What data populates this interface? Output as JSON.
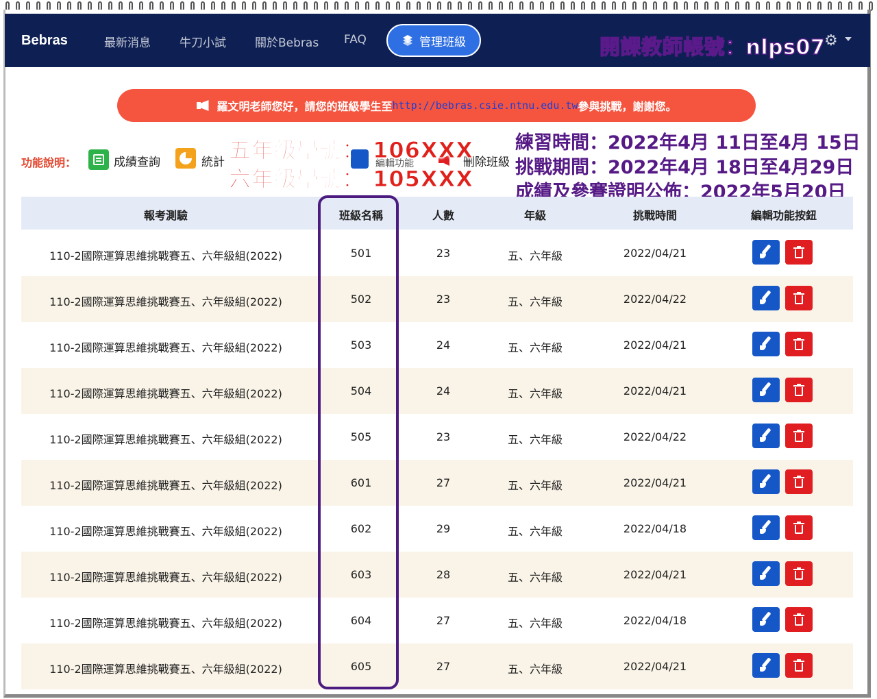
{
  "navbar": {
    "brand": "Bebras",
    "links": [
      "最新消息",
      "牛刀小試",
      "關於Bebras",
      "FAQ"
    ],
    "active_label": "管理班級",
    "teacher_prefix": "開課教師帳號：",
    "teacher_id": "nlps07"
  },
  "announcement": {
    "before": "羅文明老師您好，請您的班級學生至",
    "url": "http://bebras.csie.ntnu.edu.tw",
    "after": "參與挑戰，謝謝您。"
  },
  "legend": {
    "label": "功能說明：",
    "items": [
      "成績查詢",
      "統計",
      "編輯功能",
      "刪除班級"
    ]
  },
  "overlays": {
    "grade5": "五年級學號： 106XXX",
    "grade6": "六年級學號： 105XXX",
    "practice": "練習時間：2022年4月 11日至4月 15日",
    "challenge": "挑戰期間：2022年4月 18日至4月29日",
    "results": "成績及參賽證明公佈：2022年5月20日"
  },
  "table": {
    "headers": [
      "報考測驗",
      "班級名稱",
      "人數",
      "年級",
      "挑戰時間",
      "編輯功能按鈕"
    ],
    "rows": [
      {
        "exam": "110-2國際運算思維挑戰賽五、六年級組(2022)",
        "class": "501",
        "count": "23",
        "grade": "五、六年級",
        "date": "2022/04/21"
      },
      {
        "exam": "110-2國際運算思維挑戰賽五、六年級組(2022)",
        "class": "502",
        "count": "23",
        "grade": "五、六年級",
        "date": "2022/04/22"
      },
      {
        "exam": "110-2國際運算思維挑戰賽五、六年級組(2022)",
        "class": "503",
        "count": "24",
        "grade": "五、六年級",
        "date": "2022/04/21"
      },
      {
        "exam": "110-2國際運算思維挑戰賽五、六年級組(2022)",
        "class": "504",
        "count": "24",
        "grade": "五、六年級",
        "date": "2022/04/21"
      },
      {
        "exam": "110-2國際運算思維挑戰賽五、六年級組(2022)",
        "class": "505",
        "count": "23",
        "grade": "五、六年級",
        "date": "2022/04/22"
      },
      {
        "exam": "110-2國際運算思維挑戰賽五、六年級組(2022)",
        "class": "601",
        "count": "27",
        "grade": "五、六年級",
        "date": "2022/04/21"
      },
      {
        "exam": "110-2國際運算思維挑戰賽五、六年級組(2022)",
        "class": "602",
        "count": "29",
        "grade": "五、六年級",
        "date": "2022/04/18"
      },
      {
        "exam": "110-2國際運算思維挑戰賽五、六年級組(2022)",
        "class": "603",
        "count": "28",
        "grade": "五、六年級",
        "date": "2022/04/21"
      },
      {
        "exam": "110-2國際運算思維挑戰賽五、六年級組(2022)",
        "class": "604",
        "count": "27",
        "grade": "五、六年級",
        "date": "2022/04/18"
      },
      {
        "exam": "110-2國際運算思維挑戰賽五、六年級組(2022)",
        "class": "605",
        "count": "27",
        "grade": "五、六年級",
        "date": "2022/04/21"
      }
    ]
  },
  "colors": {
    "navbar": "#0e2053",
    "active_pill": "#2f6fe4",
    "announcement": "#f5543f",
    "edit_button": "#1657c8",
    "delete_button": "#e01e22",
    "highlight_box": "#4b1b80"
  }
}
